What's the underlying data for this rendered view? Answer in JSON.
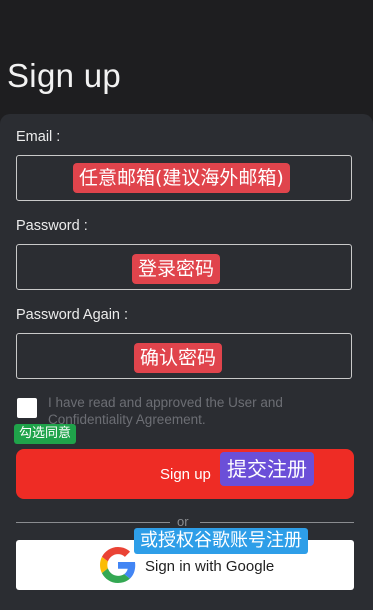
{
  "page": {
    "title": "Sign up"
  },
  "form": {
    "email": {
      "label": "Email :",
      "value": "",
      "annotation": "任意邮箱(建议海外邮箱)"
    },
    "password": {
      "label": "Password :",
      "value": "",
      "annotation": "登录密码"
    },
    "password_again": {
      "label": "Password Again :",
      "value": "",
      "annotation": "确认密码"
    },
    "agreement": {
      "checked": false,
      "text": "I have read and approved the User and Confidentiality Agreement.",
      "annotation": "勾选同意"
    },
    "signup_button": {
      "label": "Sign up",
      "annotation": "提交注册"
    },
    "divider_text": "or",
    "google_button": {
      "label": "Sign in with Google",
      "annotation": "或授权谷歌账号注册"
    }
  },
  "colors": {
    "background": "#1e1e20",
    "card": "#2b2d32",
    "signup_button": "#ee2c25",
    "annotation_red": "#e0444c",
    "annotation_green": "#1fa34a",
    "annotation_purple": "#6b4fd8",
    "annotation_blue": "#2e9ee8"
  },
  "icons": {
    "google": "google-g-icon",
    "checkbox": "checkbox-icon"
  }
}
